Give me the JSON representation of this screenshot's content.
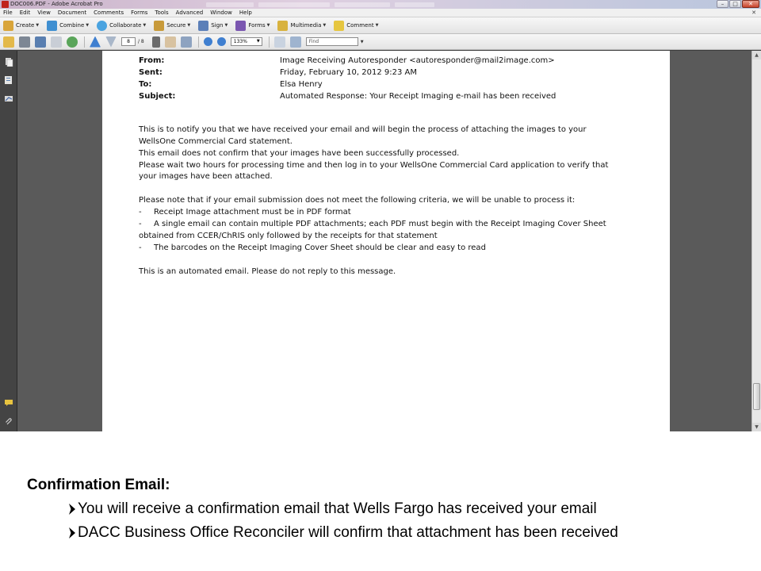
{
  "window": {
    "title": "DOC006.PDF - Adobe Acrobat Pro"
  },
  "menu": {
    "items": [
      "File",
      "Edit",
      "View",
      "Document",
      "Comments",
      "Forms",
      "Tools",
      "Advanced",
      "Window",
      "Help"
    ],
    "close_glyph": "✕"
  },
  "task_toolbar": {
    "buttons": [
      {
        "label": "Create",
        "icon": "create-pdf-icon",
        "color": "#d9a53a"
      },
      {
        "label": "Combine",
        "icon": "combine-icon",
        "color": "#3f8fd1"
      },
      {
        "label": "Collaborate",
        "icon": "collaborate-icon",
        "color": "#4aa3e0"
      },
      {
        "label": "Secure",
        "icon": "lock-icon",
        "color": "#c89a3a"
      },
      {
        "label": "Sign",
        "icon": "pen-icon",
        "color": "#5b7fb8"
      },
      {
        "label": "Forms",
        "icon": "form-icon",
        "color": "#7a56b0"
      },
      {
        "label": "Multimedia",
        "icon": "multimedia-icon",
        "color": "#d8b23e"
      },
      {
        "label": "Comment",
        "icon": "comment-icon",
        "color": "#e6c640"
      }
    ]
  },
  "nav_toolbar": {
    "current_page": "8",
    "page_total": "/ 8",
    "zoom": "133%",
    "find_placeholder": "Find"
  },
  "email": {
    "headers": [
      {
        "label": "From:",
        "value": "Image Receiving Autoresponder <autoresponder@mail2image.com>"
      },
      {
        "label": "Sent:",
        "value": "Friday, February 10, 2012 9:23 AM"
      },
      {
        "label": "To:",
        "value": "Elsa Henry"
      },
      {
        "label": "Subject:",
        "value": "Automated Response: Your Receipt Imaging e-mail has been received"
      }
    ],
    "body": {
      "p1_line1": "This is to notify you that we have received your email and will begin the process of attaching the images to your",
      "p1_line2": "WellsOne Commercial Card statement.",
      "p1_line3": "This email does not confirm that your images have been successfully processed.",
      "p1_line4": "Please wait two hours for processing time and then log in to your WellsOne Commercial Card application to verify that",
      "p1_line5": "your images have been attached.",
      "p2_line1": "Please note that if your email submission does not meet the following criteria, we will be unable to process it:",
      "dash": "-",
      "c1": "Receipt Image attachment must be in PDF format",
      "c2_line1": "A single email can contain multiple PDF attachments; each PDF must begin with the Receipt Imaging Cover Sheet",
      "c2_line2": "obtained from CCER/ChRIS only followed by the receipts for that statement",
      "c3": "The barcodes on the Receipt Imaging Cover Sheet should be clear and easy to read",
      "p3": "This is an automated email.  Please do not reply to this message."
    }
  },
  "slide": {
    "heading": "Confirmation Email:",
    "bullets": [
      "You will receive a confirmation email that Wells Fargo has received your email",
      "DACC Business Office Reconciler will confirm that attachment has been received"
    ]
  }
}
